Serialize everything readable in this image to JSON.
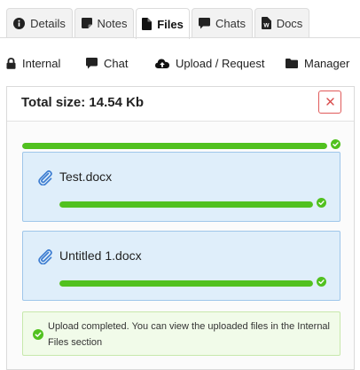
{
  "tabs": [
    {
      "label": "Details",
      "icon": "info-circle-icon"
    },
    {
      "label": "Notes",
      "icon": "sticky-note-icon"
    },
    {
      "label": "Files",
      "icon": "file-icon",
      "active": true
    },
    {
      "label": "Chats",
      "icon": "chat-bubble-icon"
    },
    {
      "label": "Docs",
      "icon": "word-doc-icon"
    }
  ],
  "subtabs": [
    {
      "label": "Internal",
      "icon": "lock-icon"
    },
    {
      "label": "Chat",
      "icon": "chat-bubble-icon"
    },
    {
      "label": "Upload / Request",
      "icon": "cloud-upload-icon",
      "active": true
    },
    {
      "label": "Manager",
      "icon": "folder-icon"
    }
  ],
  "upload": {
    "total_size": "Total size: 14.54 Kb",
    "overall_progress": 100,
    "files": [
      {
        "name": "Test.docx",
        "progress": 100
      },
      {
        "name": "Untitled 1.docx",
        "progress": 100
      }
    ],
    "message": "Upload completed. You can view the uploaded files in the Internal Files section"
  },
  "colors": {
    "progress": "#51c11f",
    "close": "#e05a5a",
    "card_bg": "#dfeefa",
    "card_border": "#9fc6ea",
    "alert_bg": "#f1fbe9"
  }
}
